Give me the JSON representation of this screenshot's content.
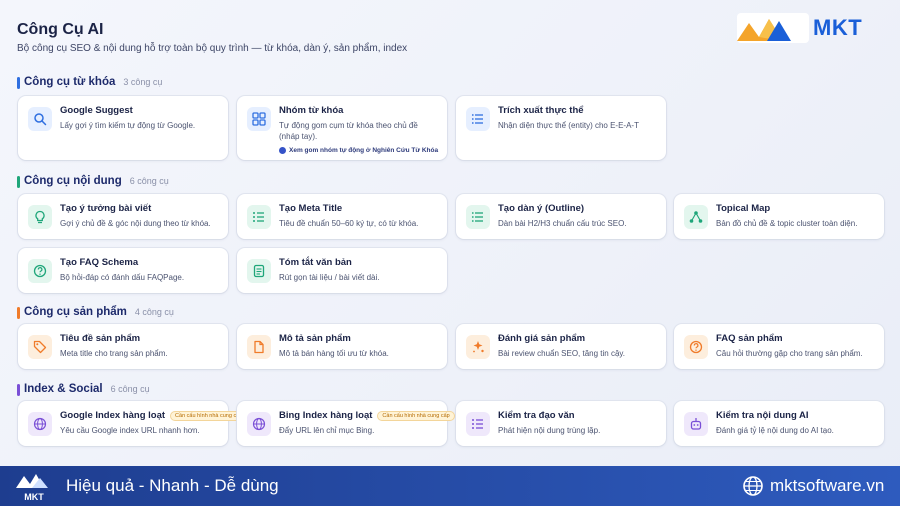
{
  "header": {
    "title": "Công Cụ AI",
    "subtitle": "Bộ công cụ SEO & nội dung hỗ trợ toàn bộ quy trình — từ khóa, dàn ý, sản phẩm, index",
    "logo_text": "MKT"
  },
  "colors": {
    "accent_blue": "#1a5fd8",
    "section_keyword": "#2f6fe0",
    "section_content": "#1fa67a",
    "section_product": "#f07b2a",
    "section_index": "#7a4fd6",
    "footer": "#1e3d8f"
  },
  "sections": [
    {
      "title": "Công cụ từ khóa",
      "count": "3 công cụ",
      "cards": [
        {
          "name": "Google Suggest",
          "desc": "Lấy gợi ý tìm kiếm tự động từ Google.",
          "icon": "search-icon"
        },
        {
          "name": "Nhóm từ khóa",
          "desc": "Tự động gom cụm từ khóa theo chủ đề (nháp tay).",
          "icon": "grid-icon",
          "note": "Xem gom nhóm tự động ở Nghiên Cứu Từ Khóa"
        },
        {
          "name": "Trích xuất thực thể",
          "desc": "Nhận diện thực thể (entity) cho E-E-A-T",
          "icon": "list-icon"
        }
      ]
    },
    {
      "title": "Công cụ nội dung",
      "count": "6 công cụ",
      "cards": [
        {
          "name": "Tạo ý tưởng bài viết",
          "desc": "Gợi ý chủ đề & góc nội dung theo từ khóa.",
          "icon": "lightbulb-icon"
        },
        {
          "name": "Tạo Meta Title",
          "desc": "Tiêu đề chuẩn 50–60 ký tự, có từ khóa.",
          "icon": "checklist-icon"
        },
        {
          "name": "Tạo dàn ý (Outline)",
          "desc": "Dàn bài H2/H3 chuẩn cấu trúc SEO.",
          "icon": "outline-icon"
        },
        {
          "name": "Topical Map",
          "desc": "Bản đồ chủ đề & topic cluster toàn diện.",
          "icon": "network-icon"
        },
        {
          "name": "Tạo FAQ Schema",
          "desc": "Bộ hỏi-đáp có đánh dấu FAQPage.",
          "icon": "question-icon"
        },
        {
          "name": "Tóm tắt văn bản",
          "desc": "Rút gọn tài liệu / bài viết dài.",
          "icon": "document-icon"
        }
      ]
    },
    {
      "title": "Công cụ sản phẩm",
      "count": "4 công cụ",
      "cards": [
        {
          "name": "Tiêu đề sản phẩm",
          "desc": "Meta title cho trang sản phẩm.",
          "icon": "tag-icon"
        },
        {
          "name": "Mô tả sản phẩm",
          "desc": "Mô tả bán hàng tối ưu từ khóa.",
          "icon": "file-icon"
        },
        {
          "name": "Đánh giá sản phẩm",
          "desc": "Bài review chuẩn SEO, tăng tin cậy.",
          "icon": "sparkle-icon"
        },
        {
          "name": "FAQ sản phẩm",
          "desc": "Câu hỏi thường gặp cho trang sản phẩm.",
          "icon": "help-icon"
        }
      ]
    },
    {
      "title": "Index & Social",
      "count": "6 công cụ",
      "cards": [
        {
          "name": "Google Index hàng loạt",
          "badge": "Cần cấu hình nhà cung cấp",
          "desc": "Yêu cầu Google index URL nhanh hơn.",
          "icon": "globe-icon"
        },
        {
          "name": "Bing Index hàng loạt",
          "badge": "Cần cấu hình nhà cung cấp",
          "desc": "Đẩy URL lên chỉ mục Bing.",
          "icon": "globe-icon"
        },
        {
          "name": "Kiểm tra đạo văn",
          "desc": "Phát hiện nội dung trùng lặp.",
          "icon": "checklist-icon"
        },
        {
          "name": "Kiểm tra nội dung AI",
          "desc": "Đánh giá tỷ lệ nội dung do AI tạo.",
          "icon": "robot-icon"
        }
      ]
    }
  ],
  "footer": {
    "slogan": "Hiệu quả - Nhanh - Dễ dùng",
    "website": "mktsoftware.vn",
    "logo_text": "MKT"
  }
}
